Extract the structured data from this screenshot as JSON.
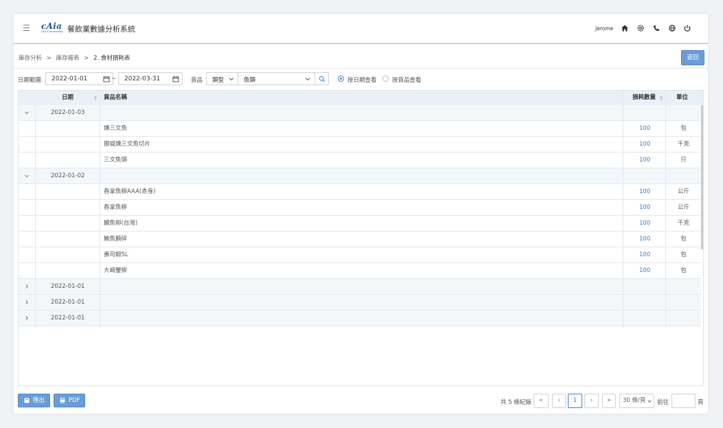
{
  "header": {
    "logo_text": "cAia",
    "logo_subtext": "City & Accounting",
    "app_title": "餐飲業數據分析系統",
    "user_name": "Jerome",
    "icons": [
      "home-icon",
      "gear-icon",
      "phone-icon",
      "globe-icon",
      "power-icon"
    ]
  },
  "breadcrumb": {
    "items": [
      "庫存分析",
      "庫存報表",
      "2. 食材損耗表"
    ],
    "separator": ">"
  },
  "back_button": "返回",
  "filters": {
    "date_range_label": "日期範圍",
    "start_date": "2022-01-01",
    "date_separator": "~",
    "end_date": "2022-03-31",
    "goods_label": "貨品",
    "type_select": "類型",
    "category_select": "魚類",
    "radio_by_date": "按日期查看",
    "radio_by_goods": "按貨品查看",
    "selected_view": "by_date"
  },
  "table": {
    "columns": [
      "日期",
      "貨品名稱",
      "損耗數量",
      "單位"
    ],
    "groups": [
      {
        "date": "2022-01-03",
        "expanded": true,
        "items": [
          {
            "name": "燻三文魚",
            "qty": "100",
            "unit": "包"
          },
          {
            "name": "挪威燻三文魚切片",
            "qty": "100",
            "unit": "千克"
          },
          {
            "name": "三文魚頭",
            "qty": "100",
            "unit": "只"
          }
        ]
      },
      {
        "date": "2022-01-02",
        "expanded": true,
        "items": [
          {
            "name": "吞拿魚柳AAA(赤身)",
            "qty": "100",
            "unit": "公斤"
          },
          {
            "name": "吞拿魚柳",
            "qty": "100",
            "unit": "公斤"
          },
          {
            "name": "鯛魚柳(台灣)",
            "qty": "100",
            "unit": "千克"
          },
          {
            "name": "鮪魚腩碎",
            "qty": "100",
            "unit": "包"
          },
          {
            "name": "壽司蝦5L",
            "qty": "100",
            "unit": "包"
          },
          {
            "name": "大崎蟹柳",
            "qty": "100",
            "unit": "包"
          }
        ]
      },
      {
        "date": "2022-01-01",
        "expanded": false,
        "items": []
      },
      {
        "date": "2022-01-01",
        "expanded": false,
        "items": []
      },
      {
        "date": "2022-01-01",
        "expanded": false,
        "items": []
      }
    ]
  },
  "footer": {
    "export_button": "匯出",
    "pdf_button": "PDF",
    "total_text": "共 5 條紀錄",
    "current_page": "1",
    "page_size": "30 條/頁",
    "goto_label": "前往",
    "goto_value": "",
    "page_suffix": "頁"
  },
  "colors": {
    "accent": "#3a7bd5",
    "button": "#6a9dd8",
    "table_header": "#e9f0f8",
    "logo": "#1f4ea3"
  }
}
